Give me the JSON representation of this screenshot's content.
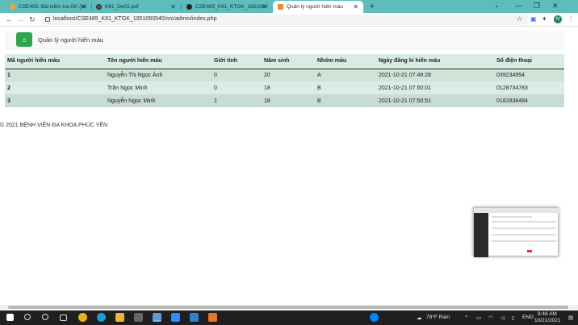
{
  "browser": {
    "tabs": [
      {
        "label": "CSE485: Bài kiểm tra GK (Mã đề",
        "active": false
      },
      {
        "label": "K61_De01.pdf",
        "active": false
      },
      {
        "label": "CSE485_K61_KTGK_1951060540",
        "active": false
      },
      {
        "label": "Quản lý người hiến máu",
        "active": true
      }
    ],
    "url": "localhost/CSE485_K61_KTGK_1951060540/src/admin/index.php",
    "profile_initial": "N"
  },
  "nav": {
    "brand": "Quản lý người hiến máu"
  },
  "table": {
    "headers": [
      "Mã người hiến máu",
      "Tên người hiến máu",
      "Giới tính",
      "Năm sinh",
      "Nhóm máu",
      "Ngày đăng kí hiến máu",
      "Số điện thoại"
    ],
    "rows": [
      [
        "1",
        "Nguyễn Thị Ngọc Ánh",
        "0",
        "20",
        "A",
        "2021-10-21 07:49:28",
        "039234954"
      ],
      [
        "2",
        "Trần Ngọc Minh",
        "0",
        "18",
        "B",
        "2021-10-21 07:50:01",
        "0128734783"
      ],
      [
        "3",
        "Nguyễn Ngọc Minh",
        "1",
        "18",
        "B",
        "2021-10-21 07:50:51",
        "0182838484"
      ]
    ]
  },
  "footer": {
    "text": "© 2021 BỆNH VIỆN ĐA KHOA PHÚC YÊN"
  },
  "taskbar": {
    "weather": "79°F  Rain",
    "lang": "ENG",
    "time": "8:48 AM",
    "date": "10/21/2021"
  }
}
